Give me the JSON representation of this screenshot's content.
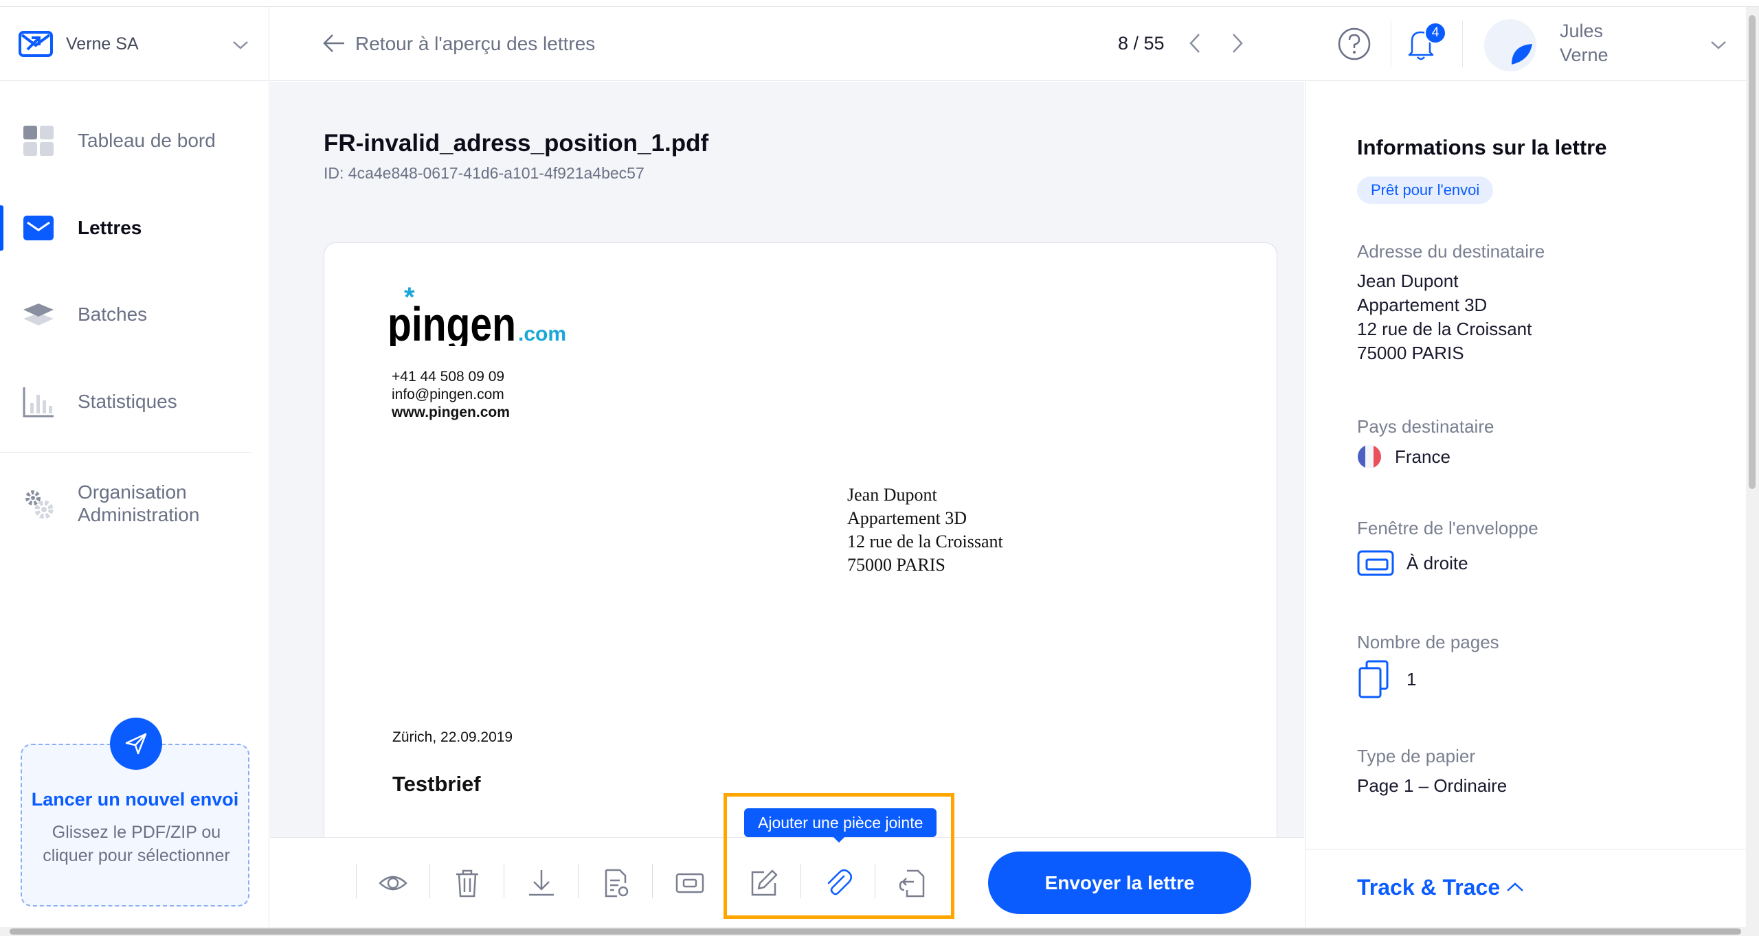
{
  "org": {
    "name": "Verne SA"
  },
  "nav": {
    "items": [
      {
        "label": "Tableau de bord",
        "icon": "dashboard-icon"
      },
      {
        "label": "Lettres",
        "icon": "letter-icon",
        "active": true
      },
      {
        "label": "Batches",
        "icon": "batches-icon"
      },
      {
        "label": "Statistiques",
        "icon": "statistics-icon"
      },
      {
        "label": "Organisation\nAdministration",
        "label_line1": "Organisation",
        "label_line2": "Administration",
        "icon": "settings-icon"
      }
    ]
  },
  "upload": {
    "title": "Lancer un nouvel envoi",
    "description": "Glissez le PDF/ZIP ou cliquer pour sélectionner",
    "icon": "send-icon"
  },
  "header": {
    "back_label": "Retour à l'aperçu des lettres",
    "pager": "8 / 55",
    "notification_count": "4",
    "user_first": "Jules",
    "user_last": "Verne"
  },
  "document": {
    "title": "FR-invalid_adress_position_1.pdf",
    "id": "ID: 4ca4e848-0617-41d6-a101-4f921a4bec57"
  },
  "letter": {
    "logo_main": "pingen",
    "logo_suffix": ".com",
    "phone": "+41 44 508 09 09",
    "email": "info@pingen.com",
    "web": "www.pingen.com",
    "address": [
      "Jean Dupont",
      "Appartement 3D",
      "12 rue de la Croissant",
      "75000 PARIS"
    ],
    "date": "Zürich, 22.09.2019",
    "subject": "Testbrief"
  },
  "toolbar": {
    "tools": [
      "preview-icon",
      "delete-icon",
      "download-icon",
      "document-edit-icon",
      "window-icon",
      "edit-icon",
      "attachment-icon",
      "return-icon"
    ],
    "tooltip": "Ajouter une pièce jointe",
    "send_label": "Envoyer la lettre"
  },
  "panel": {
    "title": "Informations sur la lettre",
    "status": "Prêt pour l'envoi",
    "recipient_label": "Adresse du destinataire",
    "recipient_lines": [
      "Jean Dupont",
      "Appartement 3D",
      "12 rue de la Croissant",
      "75000 PARIS"
    ],
    "country_label": "Pays destinataire",
    "country_value": "France",
    "window_label": "Fenêtre de l'enveloppe",
    "window_value": "À droite",
    "pages_label": "Nombre de pages",
    "pages_value": "1",
    "paper_label": "Type de papier",
    "paper_value": "Page 1 – Ordinaire",
    "track_label": "Track & Trace"
  },
  "colors": {
    "accent": "#0a5cff",
    "highlight": "#ffa500",
    "muted": "#6b7185"
  }
}
